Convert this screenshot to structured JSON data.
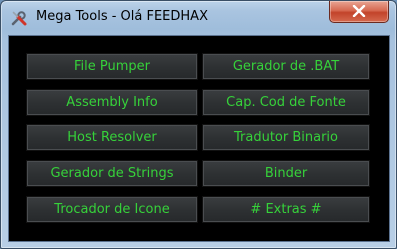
{
  "window": {
    "title": "Mega Tools - Olá FEEDHAX",
    "icon": "tools-icon",
    "close_icon": "close-icon"
  },
  "colors": {
    "button_text": "#36d23a",
    "client_background": "#000000",
    "button_background": "#2e3133",
    "close_button": "#c2432a"
  },
  "buttons": {
    "left": [
      "File Pumper",
      "Assembly Info",
      "Host Resolver",
      "Gerador de Strings",
      "Trocador de Icone"
    ],
    "right": [
      "Gerador de .BAT",
      "Cap. Cod de Fonte",
      "Tradutor Binario",
      "Binder",
      "# Extras #"
    ]
  }
}
